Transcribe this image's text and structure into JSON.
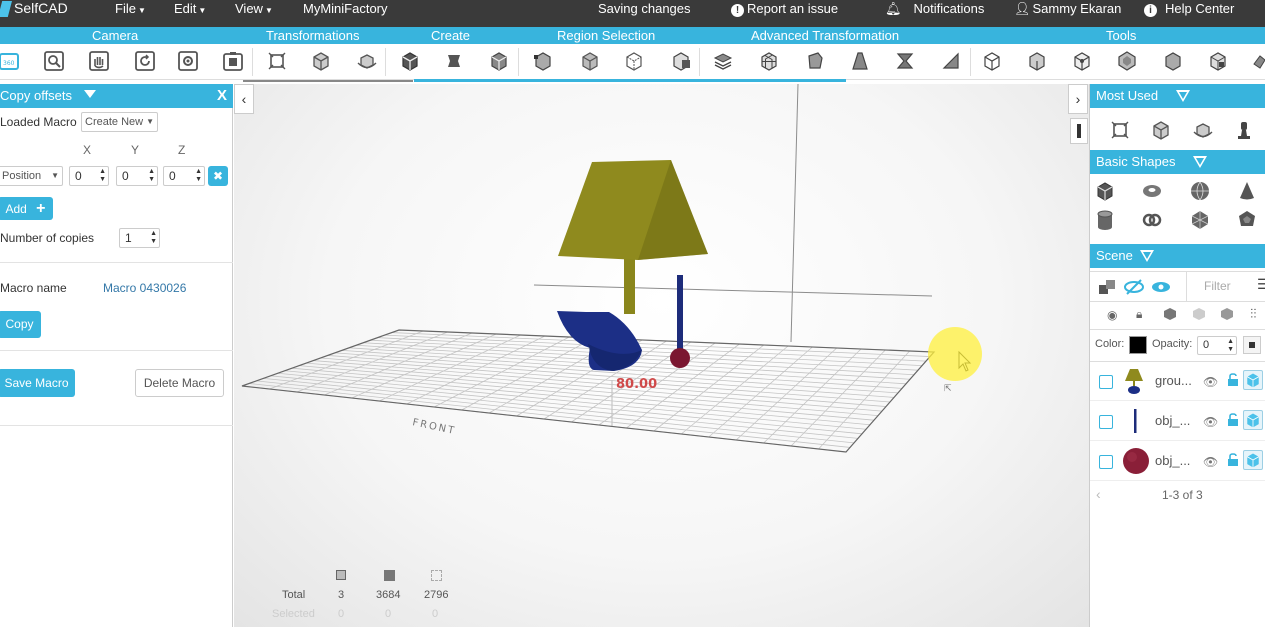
{
  "menubar": {
    "logo_text": "SelfCAD",
    "file": "File",
    "edit": "Edit",
    "view": "View",
    "myminifactory": "MyMiniFactory",
    "saving_status": "Saving changes",
    "report": "Report an issue",
    "notifications": "Notifications",
    "user": "Sammy Ekaran",
    "help": "Help Center"
  },
  "sections": {
    "camera": "Camera",
    "transformations": "Transformations",
    "create": "Create",
    "region_selection": "Region Selection",
    "advanced_transformation": "Advanced Transformation",
    "tools": "Tools"
  },
  "left_panel": {
    "title": "Copy offsets",
    "close": "X",
    "loaded_macro_label": "Loaded Macro",
    "loaded_macro_value": "Create New",
    "axis_x": "X",
    "axis_y": "Y",
    "axis_z": "Z",
    "offset_type": "Position",
    "x_value": "0",
    "y_value": "0",
    "z_value": "0",
    "remove": "✖",
    "add_label": "Add",
    "add_icon": "+",
    "copies_label": "Number of copies",
    "copies_value": "1",
    "macro_name_label": "Macro name",
    "macro_name_value": "Macro 0430026",
    "copy_button": "Copy",
    "save_macro_button": "Save Macro",
    "delete_macro_button": "Delete Macro"
  },
  "viewport": {
    "measurement_label": "80.00",
    "front_label": "FRONT",
    "stats": {
      "total_label": "Total",
      "selected_label": "Selected",
      "total_values": [
        "3",
        "3684",
        "2796"
      ],
      "selected_values": [
        "0",
        "0",
        "0"
      ]
    },
    "colors": {
      "lampshade": "#8f8a1e",
      "lamp_stem": "#8a861c",
      "lamp_base": "#1c2f86",
      "rod": "#1d2c7a",
      "ball": "#7b1630"
    }
  },
  "right_panel": {
    "most_used_title": "Most Used",
    "basic_shapes_title": "Basic Shapes",
    "scene_title": "Scene",
    "filter_placeholder": "Filter",
    "color_label": "Color:",
    "color_value": "#000000",
    "opacity_label": "Opacity:",
    "opacity_value": "0",
    "scene_items": [
      {
        "name": "grou..."
      },
      {
        "name": "obj_..."
      },
      {
        "name": "obj_..."
      }
    ],
    "pagination": "1-3 of 3"
  }
}
